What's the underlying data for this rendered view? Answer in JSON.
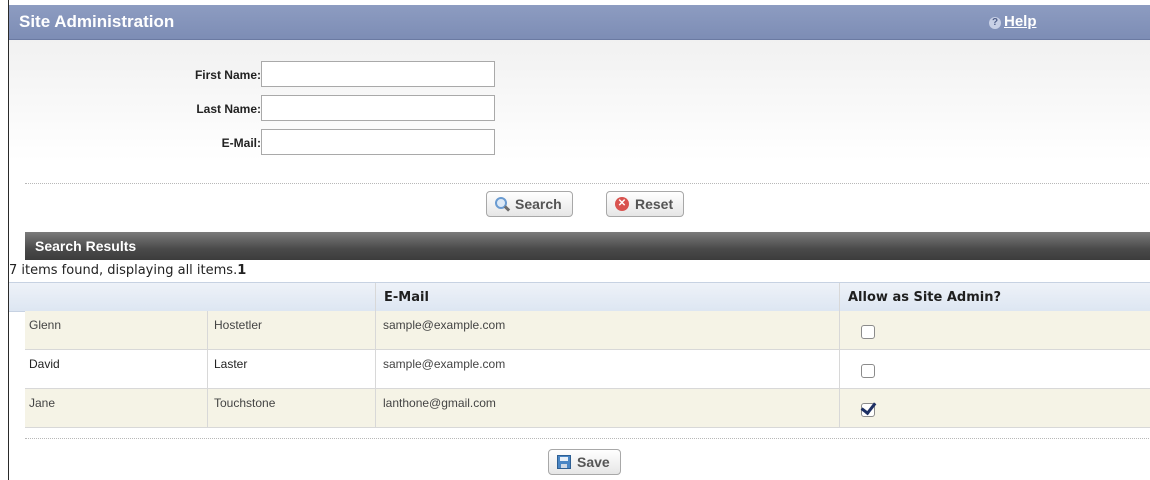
{
  "header": {
    "title": "Site Administration",
    "help_label": "Help"
  },
  "form": {
    "first_name_label": "First Name:",
    "last_name_label": "Last Name:",
    "email_label": "E-Mail:",
    "first_name_value": "",
    "last_name_value": "",
    "email_value": "",
    "search_button": "Search",
    "reset_button": "Reset"
  },
  "results": {
    "title": "Search Results",
    "count_text": "7 items found, displaying all items.",
    "page_number": "1",
    "columns": [
      "",
      "",
      "E-Mail",
      "Allow as Site Admin?"
    ],
    "rows": [
      {
        "first": "Glenn",
        "last": "Hostetler",
        "email": "sample@example.com",
        "admin": false
      },
      {
        "first": "David",
        "last": "Laster",
        "email": "sample@example.com",
        "admin": false
      },
      {
        "first": "Jane",
        "last": "Touchstone",
        "email": "lanthone@gmail.com",
        "admin": true
      }
    ],
    "save_button": "Save"
  }
}
